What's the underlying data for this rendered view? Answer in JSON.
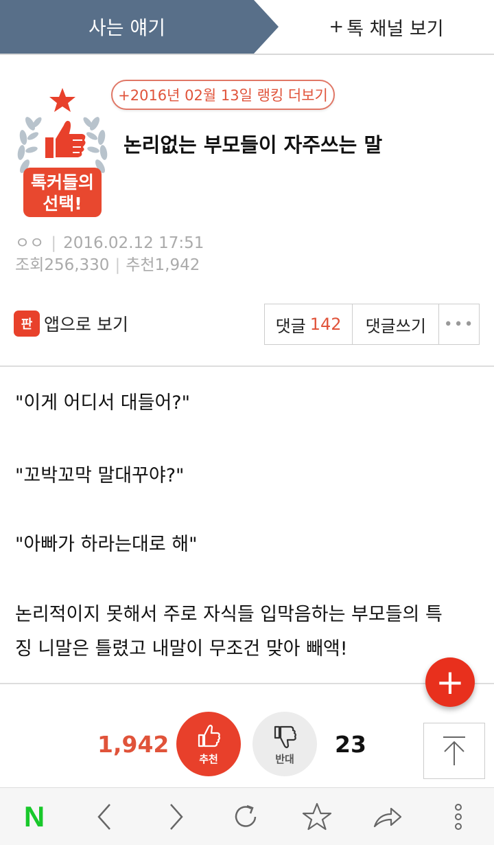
{
  "tabs": {
    "active_label": "사는 얘기",
    "other_plus": "+",
    "other_label": "톡 채널 보기"
  },
  "badge": {
    "line1": "톡커들의",
    "line2": "선택!",
    "icons": [
      "star-icon",
      "thumbs-up-icon",
      "laurel-icon"
    ]
  },
  "post": {
    "ranking_link": "+2016년 02월 13일 랭킹 더보기",
    "title": "논리없는 부모들이 자주쓰는 말",
    "author": "ㅇㅇ",
    "datetime": "2016.02.12 17:51",
    "views_label": "조회",
    "views": "256,330",
    "recommend_label": "추천",
    "recommend": "1,942"
  },
  "actions": {
    "app_icon_text": "판",
    "app_view_label": "앱으로 보기",
    "comments_label": "댓글",
    "comments_count": "142",
    "write_comment_label": "댓글쓰기",
    "more_label": "•••"
  },
  "body": {
    "line1": "\"이게 어디서 대들어?\"",
    "line2": "\"꼬박꼬막 말대꾸야?\"",
    "line3": "\"아빠가 하라는대로 해\"",
    "line4a": "논리적이지 못해서 주로 자식들 입막음하는 부모들의 특",
    "line4b": "징 니말은 틀렸고 내말이 무조건 맞아 빼액!"
  },
  "fab": {
    "label": "+"
  },
  "votes": {
    "up_count": "1,942",
    "up_label": "추천",
    "down_label": "반대",
    "down_count": "23"
  },
  "colors": {
    "header_tab": "#586f89",
    "accent_red": "#e0533a",
    "naver_green": "#19c82b"
  },
  "navbar": {
    "items": [
      "naver-logo",
      "back-icon",
      "forward-icon",
      "refresh-icon",
      "bookmark-star-icon",
      "share-icon",
      "more-vertical-icon"
    ],
    "logo_text": "N"
  }
}
